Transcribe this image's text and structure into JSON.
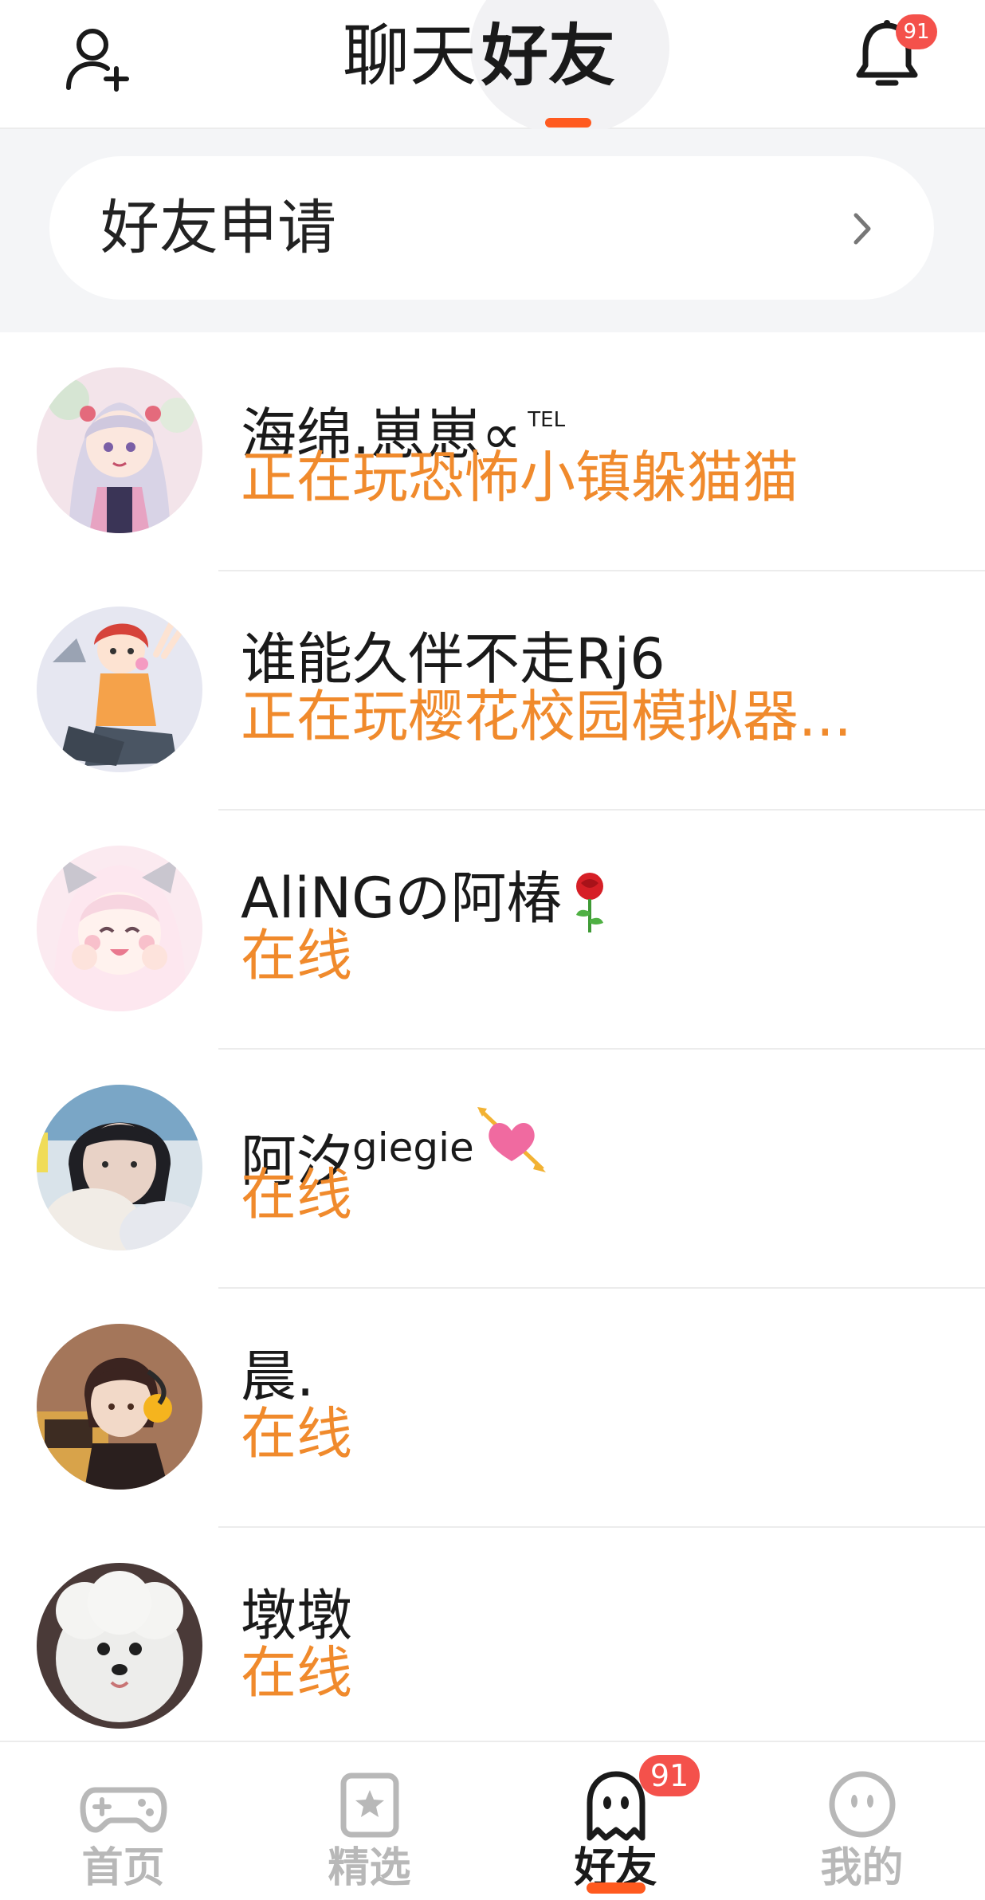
{
  "header": {
    "tab_chat": "聊天",
    "tab_friends": "好友",
    "notification_count": "91",
    "icons": {
      "left": "add-friend-icon",
      "right": "bell-icon"
    }
  },
  "request": {
    "label": "好友申请",
    "icon": "chevron-right-icon"
  },
  "friends": [
    {
      "name": "海绵.崽崽∝",
      "name_suffix": "TEL",
      "status": "正在玩恐怖小镇躲猫猫"
    },
    {
      "name": "谁能久伴不走Rj6",
      "status": "正在玩樱花校园模拟器..."
    },
    {
      "name": "AliNGの阿椿",
      "emoji": "rose-emoji",
      "status": "在线"
    },
    {
      "name": "阿汐",
      "name_suffix": "giegie",
      "emoji": "heart-arrow-emoji",
      "status": "在线"
    },
    {
      "name": "晨.",
      "status": "在线"
    },
    {
      "name": "墩墩",
      "status": "在线"
    }
  ],
  "nav": {
    "items": [
      {
        "label": "首页",
        "icon": "gamepad-icon"
      },
      {
        "label": "精选",
        "icon": "star-card-icon"
      },
      {
        "label": "好友",
        "icon": "ghost-icon",
        "badge": "91",
        "active": true
      },
      {
        "label": "我的",
        "icon": "face-icon"
      }
    ]
  },
  "colors": {
    "accent": "#ff5a1f",
    "status_orange": "#f08a2c",
    "badge_red": "#f4514b",
    "inactive_gray": "#b8b8b8"
  }
}
